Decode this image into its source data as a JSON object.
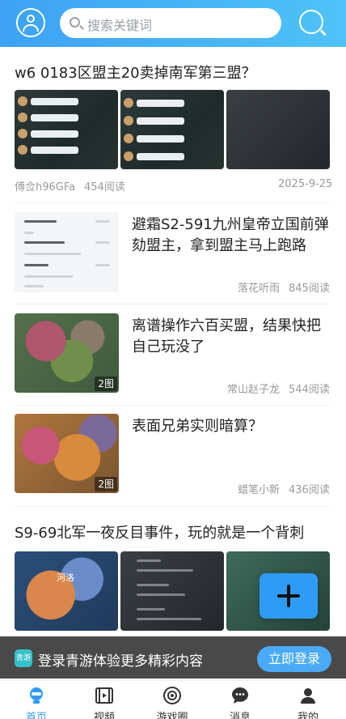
{
  "header": {
    "search_placeholder": "搜索关键词"
  },
  "posts": [
    {
      "title": "w6 0183区盟主20卖掉南军第三盟？",
      "author": "傅佥h96GFa",
      "reads": "454阅读",
      "date": "2025-9-25"
    },
    {
      "title": "避霜S2-591九州皇帝立国前弹劾盟主，拿到盟主马上跑路",
      "author": "落花听雨",
      "reads": "845阅读"
    },
    {
      "title": "离谱操作六百买盟，结果快把自己玩没了",
      "author": "常山赵子龙",
      "reads": "544阅读",
      "badge": "2图"
    },
    {
      "title": "表面兄弟实则暗算？",
      "author": "蜡笔小新",
      "reads": "436阅读",
      "badge": "2图"
    },
    {
      "title": "S9-69北军一夜反目事件，玩的就是一个背刺",
      "map_label": "河洛"
    }
  ],
  "login_bar": {
    "logo_text": "青游",
    "text": "登录青游体验更多精彩内容",
    "button": "立即登录"
  },
  "tabs": [
    {
      "label": "首页",
      "icon": "home-icon",
      "active": true
    },
    {
      "label": "视频",
      "icon": "video-icon"
    },
    {
      "label": "游戏圈",
      "icon": "game-circle-icon"
    },
    {
      "label": "消息",
      "icon": "message-icon"
    },
    {
      "label": "我的",
      "icon": "profile-icon"
    }
  ],
  "colors": {
    "header_gradient_start": "#3da2f5",
    "header_gradient_end": "#4fc3f7",
    "accent": "#2f9cf6",
    "fab": "#2e9cf6"
  }
}
